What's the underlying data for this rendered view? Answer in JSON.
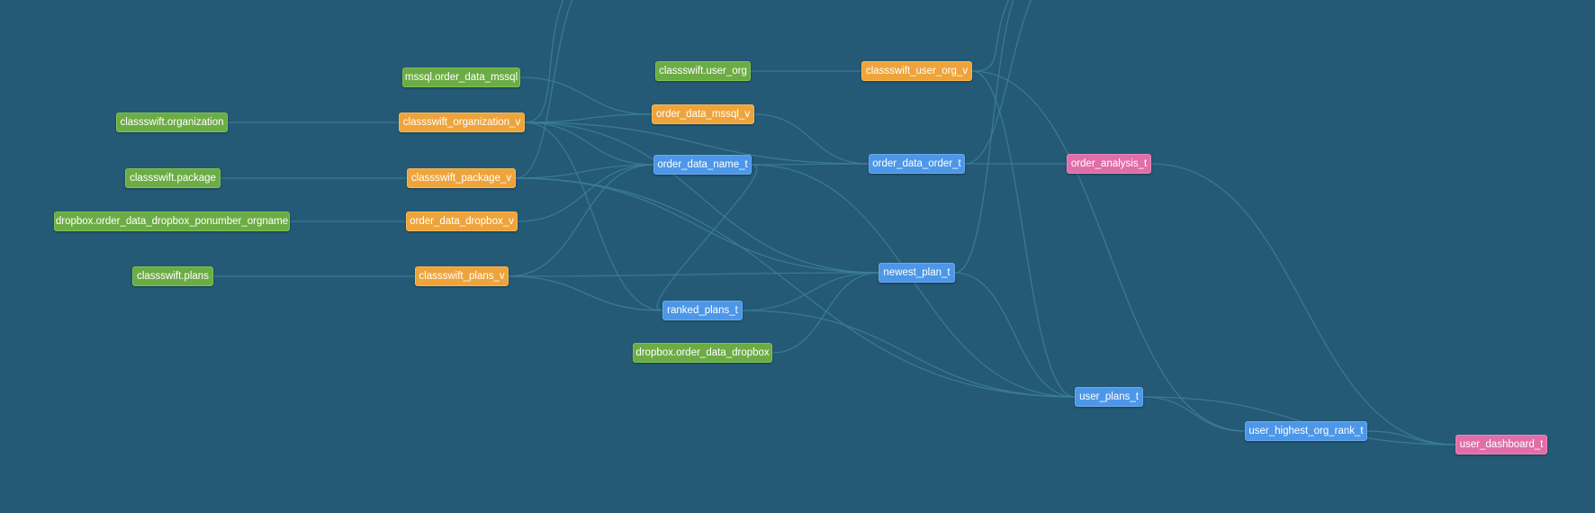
{
  "colors": {
    "background": "#245a76",
    "edge": "#3d7f98",
    "source": "#6cac45",
    "view": "#eea43b",
    "table": "#4d97e8",
    "final": "#e06ea9"
  },
  "nodes": [
    {
      "id": "mssql_order_data_mssql",
      "label": "mssql.order_data_mssql",
      "kind": "source"
    },
    {
      "id": "classswift_organization",
      "label": "classswift.organization",
      "kind": "source"
    },
    {
      "id": "classswift_package",
      "label": "classswift.package",
      "kind": "source"
    },
    {
      "id": "dropbox_order_data_dropbox_ponumber_orgname",
      "label": "dropbox.order_data_dropbox_ponumber_orgname",
      "kind": "source"
    },
    {
      "id": "classswift_plans",
      "label": "classswift.plans",
      "kind": "source"
    },
    {
      "id": "classswift_user_org",
      "label": "classswift.user_org",
      "kind": "source"
    },
    {
      "id": "dropbox_order_data_dropbox",
      "label": "dropbox.order_data_dropbox",
      "kind": "source"
    },
    {
      "id": "classswift_organization_v",
      "label": "classswift_organization_v",
      "kind": "view"
    },
    {
      "id": "classswift_package_v",
      "label": "classswift_package_v",
      "kind": "view"
    },
    {
      "id": "order_data_dropbox_v",
      "label": "order_data_dropbox_v",
      "kind": "view"
    },
    {
      "id": "classswift_plans_v",
      "label": "classswift_plans_v",
      "kind": "view"
    },
    {
      "id": "order_data_mssql_v",
      "label": "order_data_mssql_v",
      "kind": "view"
    },
    {
      "id": "classswift_user_org_v",
      "label": "classswift_user_org_v",
      "kind": "view"
    },
    {
      "id": "order_data_name_t",
      "label": "order_data_name_t",
      "kind": "table"
    },
    {
      "id": "ranked_plans_t",
      "label": "ranked_plans_t",
      "kind": "table"
    },
    {
      "id": "order_data_order_t",
      "label": "order_data_order_t",
      "kind": "table"
    },
    {
      "id": "newest_plan_t",
      "label": "newest_plan_t",
      "kind": "table"
    },
    {
      "id": "user_plans_t",
      "label": "user_plans_t",
      "kind": "table"
    },
    {
      "id": "user_highest_org_rank_t",
      "label": "user_highest_org_rank_t",
      "kind": "table"
    },
    {
      "id": "order_analysis_t",
      "label": "order_analysis_t",
      "kind": "final"
    },
    {
      "id": "user_dashboard_t",
      "label": "user_dashboard_t",
      "kind": "final"
    }
  ],
  "edges": [
    [
      "classswift_organization",
      "classswift_organization_v"
    ],
    [
      "classswift_package",
      "classswift_package_v"
    ],
    [
      "dropbox_order_data_dropbox_ponumber_orgname",
      "order_data_dropbox_v"
    ],
    [
      "classswift_plans",
      "classswift_plans_v"
    ],
    [
      "mssql_order_data_mssql",
      "order_data_mssql_v"
    ],
    [
      "classswift_user_org",
      "classswift_user_org_v"
    ],
    [
      "classswift_organization_v",
      "order_data_mssql_v"
    ],
    [
      "classswift_organization_v",
      "order_data_name_t"
    ],
    [
      "classswift_organization_v",
      "order_data_order_t"
    ],
    [
      "classswift_organization_v",
      "ranked_plans_t"
    ],
    [
      "classswift_organization_v",
      "newest_plan_t"
    ],
    [
      "classswift_package_v",
      "order_data_name_t"
    ],
    [
      "classswift_package_v",
      "newest_plan_t"
    ],
    [
      "classswift_package_v",
      "user_plans_t"
    ],
    [
      "order_data_dropbox_v",
      "order_data_name_t"
    ],
    [
      "classswift_plans_v",
      "ranked_plans_t"
    ],
    [
      "classswift_plans_v",
      "newest_plan_t"
    ],
    [
      "classswift_plans_v",
      "order_data_name_t"
    ],
    [
      "order_data_mssql_v",
      "order_data_order_t"
    ],
    [
      "order_data_name_t",
      "order_data_order_t"
    ],
    [
      "order_data_name_t",
      "ranked_plans_t"
    ],
    [
      "order_data_name_t",
      "user_plans_t"
    ],
    [
      "dropbox_order_data_dropbox",
      "newest_plan_t"
    ],
    [
      "ranked_plans_t",
      "newest_plan_t"
    ],
    [
      "ranked_plans_t",
      "user_plans_t"
    ],
    [
      "order_data_order_t",
      "order_analysis_t"
    ],
    [
      "newest_plan_t",
      "user_plans_t"
    ],
    [
      "classswift_user_org_v",
      "user_plans_t"
    ],
    [
      "classswift_user_org_v",
      "user_highest_org_rank_t"
    ],
    [
      "user_plans_t",
      "user_highest_org_rank_t"
    ],
    [
      "user_plans_t",
      "user_dashboard_t"
    ],
    [
      "user_highest_org_rank_t",
      "user_dashboard_t"
    ],
    [
      "order_analysis_t",
      "user_dashboard_t"
    ]
  ]
}
